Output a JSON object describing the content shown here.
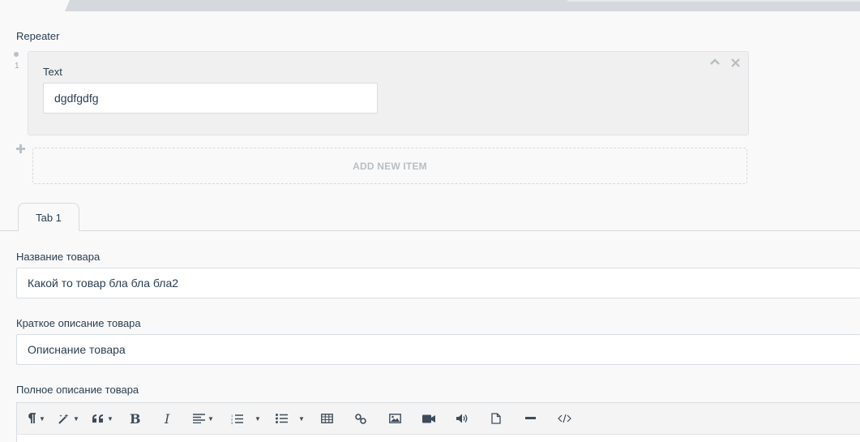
{
  "repeater": {
    "label": "Repeater",
    "items": [
      {
        "index": "1",
        "field_label": "Text",
        "field_value": "dgdfgdfg"
      }
    ],
    "add_new_label": "ADD NEW ITEM"
  },
  "tabs": [
    {
      "label": "Tab 1"
    }
  ],
  "fields": {
    "name": {
      "label": "Название товара",
      "value": "Какой то товар бла бла бла2"
    },
    "short_desc": {
      "label": "Краткое описание товара",
      "value": "Опиcнание товара"
    },
    "full_desc": {
      "label": "Полное описание товара"
    }
  },
  "toolbar": {
    "buttons": [
      "paragraph-style-icon",
      "magic-style-icon",
      "quote-icon",
      "bold-icon",
      "italic-icon",
      "align-icon",
      "ordered-list-icon",
      "unordered-list-icon",
      "table-icon",
      "link-icon",
      "image-icon",
      "video-icon",
      "audio-icon",
      "file-icon",
      "horizontal-rule-icon",
      "code-view-icon"
    ]
  }
}
